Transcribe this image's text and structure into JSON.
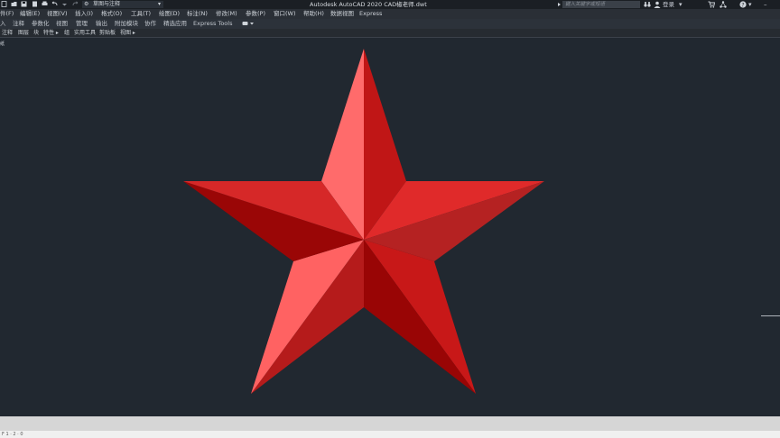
{
  "titlebar": {
    "workspace": "草图与注释",
    "app_title": "Autodesk AutoCAD 2020    CAD椒老师.dwt",
    "search_placeholder": "键入关键字或短语",
    "login": "登录"
  },
  "menubar": {
    "items": [
      "件(F)",
      "编辑(E)",
      "视图(V)",
      "插入(I)",
      "格式(O)",
      "工具(T)",
      "绘图(D)",
      "标注(N)",
      "修改(M)",
      "参数(P)",
      "窗口(W)",
      "帮助(H)",
      "数据视图",
      "Express"
    ]
  },
  "ribbon_tabs": {
    "items": [
      "入",
      "注释",
      "参数化",
      "视图",
      "管理",
      "输出",
      "附加模块",
      "协作",
      "精选应用",
      "Express Tools"
    ]
  },
  "panel_tabs": {
    "items": [
      "注释",
      "图层",
      "块",
      "特性 ▸",
      "组",
      "实用工具",
      "剪贴板",
      "视图 ▸"
    ]
  },
  "canvas": {
    "corner_mark": "纸",
    "background": "#212830",
    "star_colors": [
      "#ff6b6b",
      "#c01616",
      "#e02a2a",
      "#a00808",
      "#d42424",
      "#8f0303",
      "#ff5a5a",
      "#b51b1b",
      "#cf1a1a",
      "#990505"
    ]
  },
  "cmdline": {
    "text": "F 1 · 2 · 0"
  }
}
